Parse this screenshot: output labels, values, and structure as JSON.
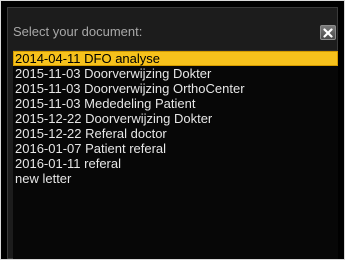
{
  "dialog": {
    "title": "Select your document:",
    "close_icon": "close-x-icon"
  },
  "documents": [
    {
      "label": "2014-04-11 DFO analyse",
      "selected": true
    },
    {
      "label": "2015-11-03 Doorverwijzing Dokter",
      "selected": false
    },
    {
      "label": "2015-11-03 Doorverwijzing OrthoCenter",
      "selected": false
    },
    {
      "label": "2015-11-03 Mededeling Patient",
      "selected": false
    },
    {
      "label": "2015-12-22 Doorverwijzing Dokter",
      "selected": false
    },
    {
      "label": "2015-12-22 Referal doctor",
      "selected": false
    },
    {
      "label": "2016-01-07 Patient referal",
      "selected": false
    },
    {
      "label": "2016-01-11  referal",
      "selected": false
    },
    {
      "label": "new letter",
      "selected": false
    }
  ],
  "colors": {
    "selection": "#f7c21c",
    "background": "#070707",
    "text": "#e6e6e6"
  }
}
